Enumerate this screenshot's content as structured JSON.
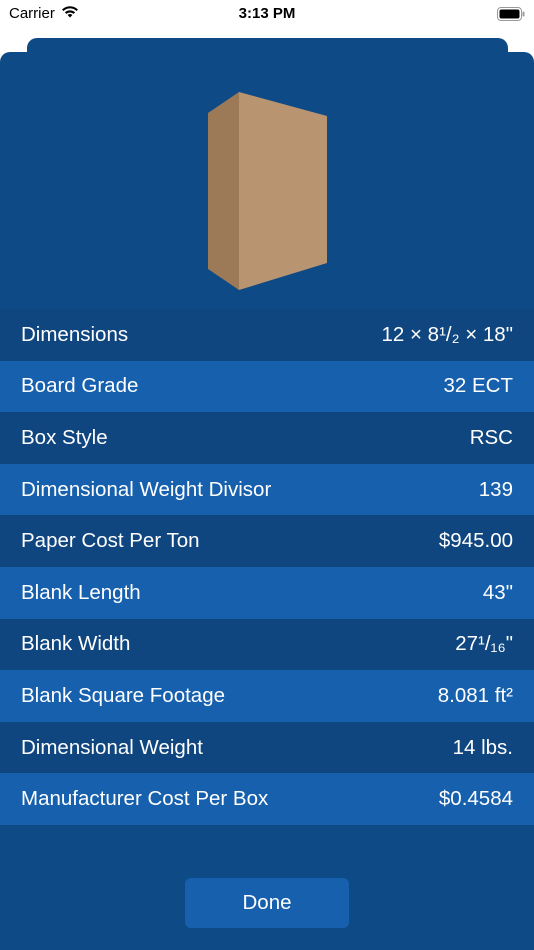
{
  "status_bar": {
    "carrier": "Carrier",
    "time": "3:13 PM",
    "wifi_icon": "wifi-icon",
    "battery_icon": "battery-icon"
  },
  "box_colors": {
    "front": "#b89470",
    "side": "#9c7a57",
    "top": "#d2b08a"
  },
  "rows": [
    {
      "label": "Dimensions",
      "value": "12 × 8¹/₂ × 18\""
    },
    {
      "label": "Board Grade",
      "value": "32 ECT"
    },
    {
      "label": "Box Style",
      "value": "RSC"
    },
    {
      "label": "Dimensional Weight Divisor",
      "value": "139"
    },
    {
      "label": "Paper Cost Per Ton",
      "value": "$945.00"
    },
    {
      "label": "Blank Length",
      "value": "43\""
    },
    {
      "label": "Blank Width",
      "value": "27¹/₁₆\""
    },
    {
      "label": "Blank Square Footage",
      "value": "8.081 ft²"
    },
    {
      "label": "Dimensional Weight",
      "value": "14 lbs."
    },
    {
      "label": "Manufacturer Cost Per Box",
      "value": "$0.4584"
    }
  ],
  "done_label": "Done"
}
